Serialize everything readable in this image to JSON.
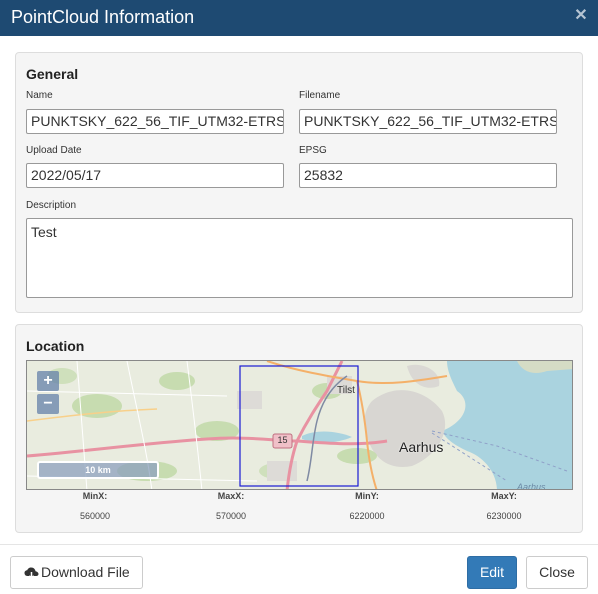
{
  "dialog": {
    "title": "PointCloud Information",
    "close_icon": "close-icon"
  },
  "general": {
    "heading": "General",
    "name_label": "Name",
    "name_value": "PUNKTSKY_622_56_TIF_UTM32-ETRS",
    "filename_label": "Filename",
    "filename_value": "PUNKTSKY_622_56_TIF_UTM32-ETRS",
    "upload_date_label": "Upload Date",
    "upload_date_value": "2022/05/17",
    "epsg_label": "EPSG",
    "epsg_value": "25832",
    "description_label": "Description",
    "description_value": "Test"
  },
  "location": {
    "heading": "Location",
    "zoom_in": "+",
    "zoom_out": "−",
    "scale_label": "10 km",
    "map_labels": {
      "city": "Aarhus",
      "town": "Tilst",
      "road": "15",
      "sea": "Aarhus"
    },
    "minx_label": "MinX:",
    "minx_value": "560000",
    "maxx_label": "MaxX:",
    "maxx_value": "570000",
    "miny_label": "MinY:",
    "miny_value": "6220000",
    "maxy_label": "MaxY:",
    "maxy_value": "6230000"
  },
  "footer": {
    "download_label": "Download File",
    "download_icon": "cloud-download-icon",
    "edit_label": "Edit",
    "close_label": "Close"
  },
  "colors": {
    "header_bg": "#1e4a72",
    "primary": "#337ab7",
    "bbox": "#1a1ad4"
  }
}
